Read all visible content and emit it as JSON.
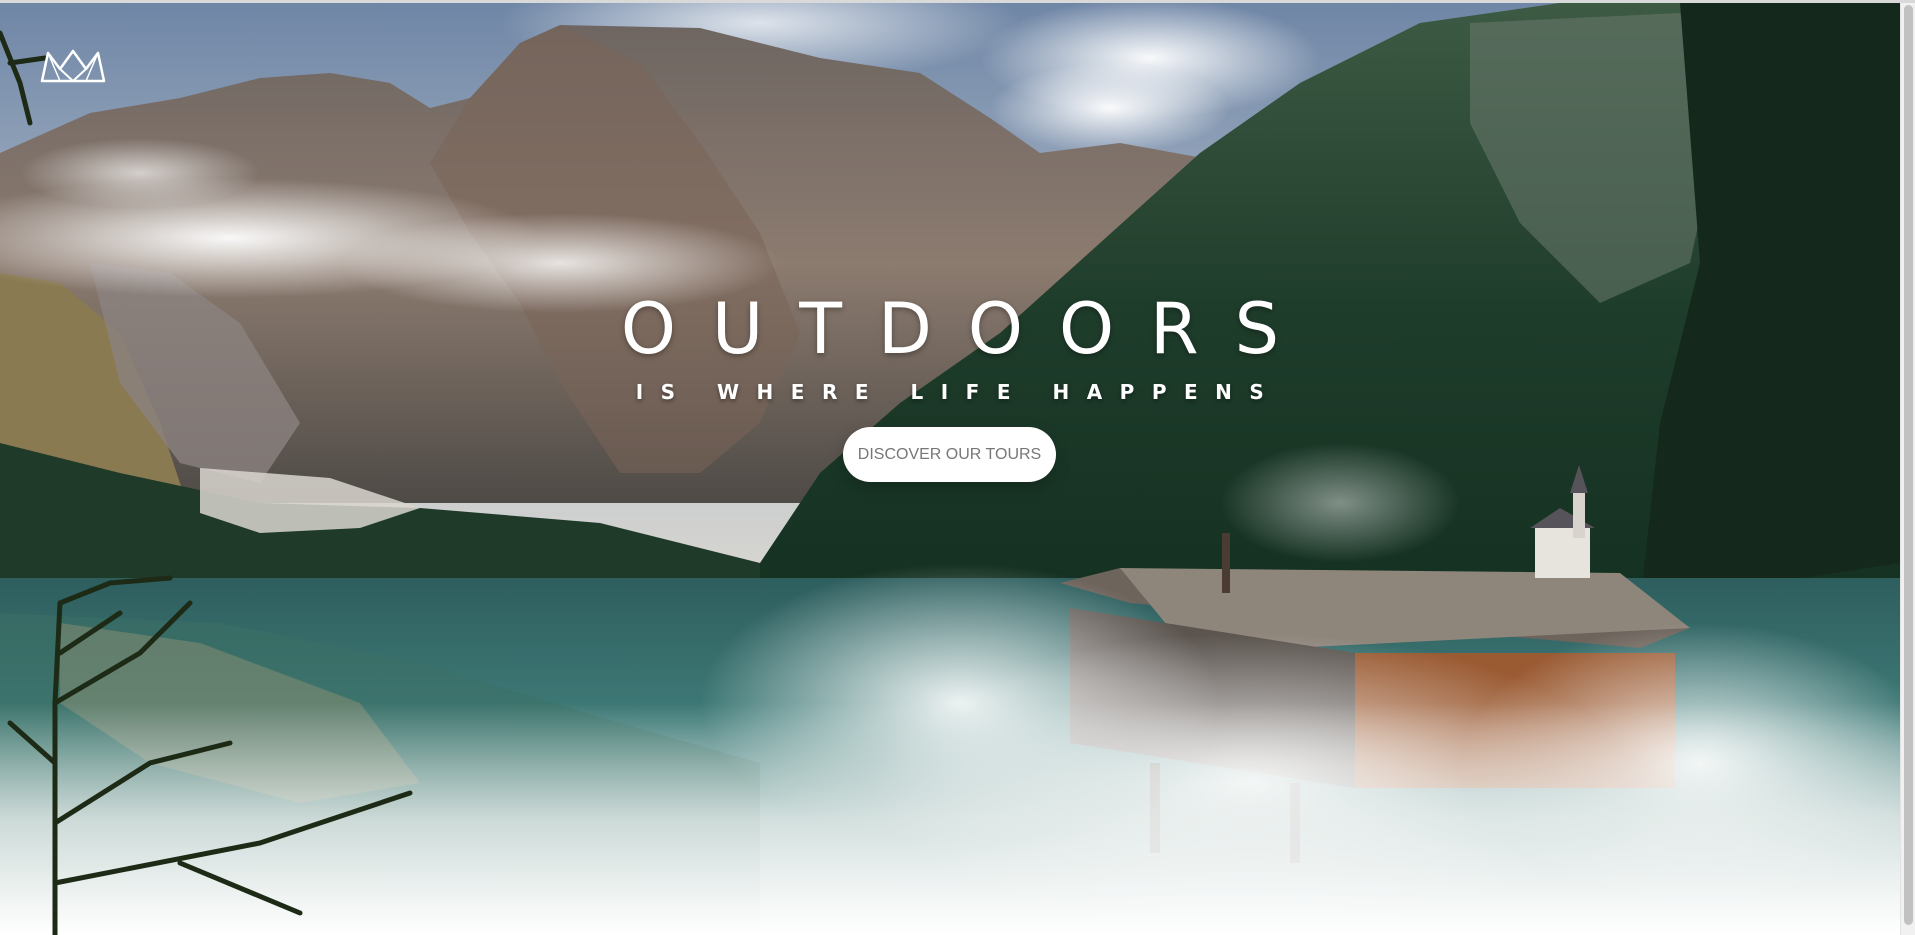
{
  "hero": {
    "logo_icon": "crown-icon",
    "heading_main": "OUTDOORS",
    "heading_sub": "IS WHERE LIFE HAPPENS",
    "cta_label": "DISCOVER OUR TOURS"
  },
  "colors": {
    "heading_text": "#ffffff",
    "cta_background": "#ffffff",
    "cta_text": "#777777"
  }
}
